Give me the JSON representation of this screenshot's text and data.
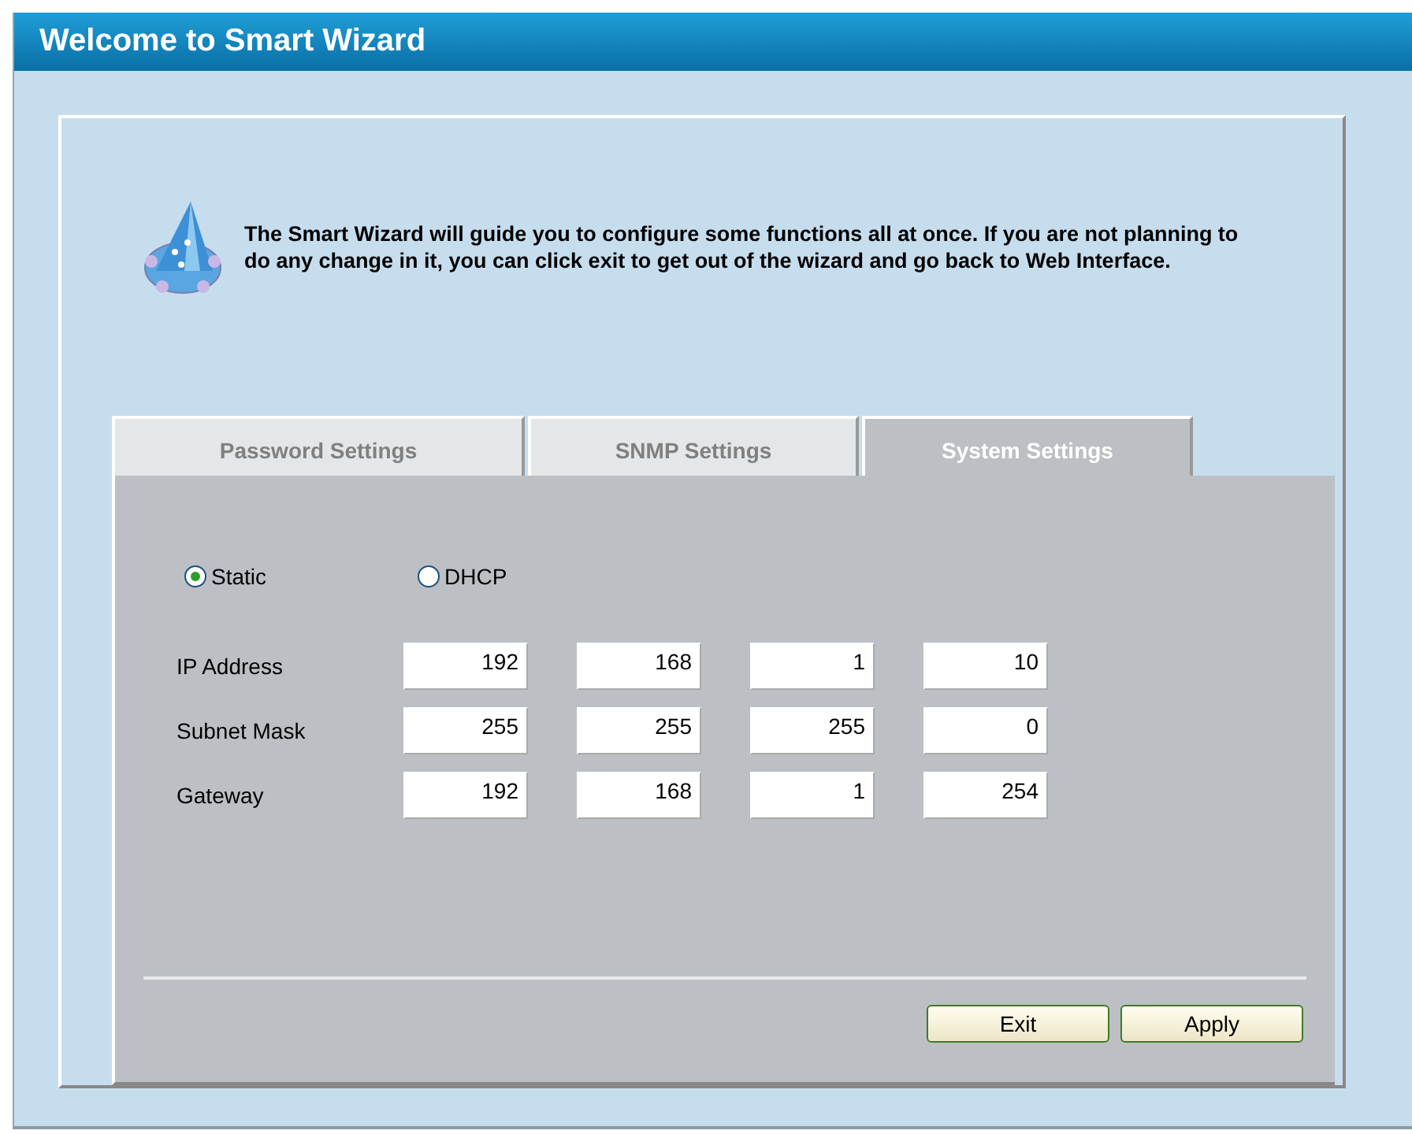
{
  "window": {
    "title": "Welcome to Smart Wizard"
  },
  "intro": "The Smart Wizard will guide you to configure some functions all at once. If you are not planning to do any change in it, you can click exit to get out of the wizard and go back to Web Interface.",
  "tabs": [
    {
      "label": "Password Settings",
      "selected": false
    },
    {
      "label": "SNMP Settings",
      "selected": false
    },
    {
      "label": "System Settings",
      "selected": true
    }
  ],
  "mode": [
    {
      "label": "Static",
      "selected": true
    },
    {
      "label": "DHCP",
      "selected": false
    }
  ],
  "fields": [
    {
      "label": "IP Address",
      "octets": [
        "192",
        "168",
        "1",
        "10"
      ]
    },
    {
      "label": "Subnet Mask",
      "octets": [
        "255",
        "255",
        "255",
        "0"
      ]
    },
    {
      "label": "Gateway",
      "octets": [
        "192",
        "168",
        "1",
        "254"
      ]
    }
  ],
  "buttons": [
    "Exit",
    "Apply"
  ]
}
